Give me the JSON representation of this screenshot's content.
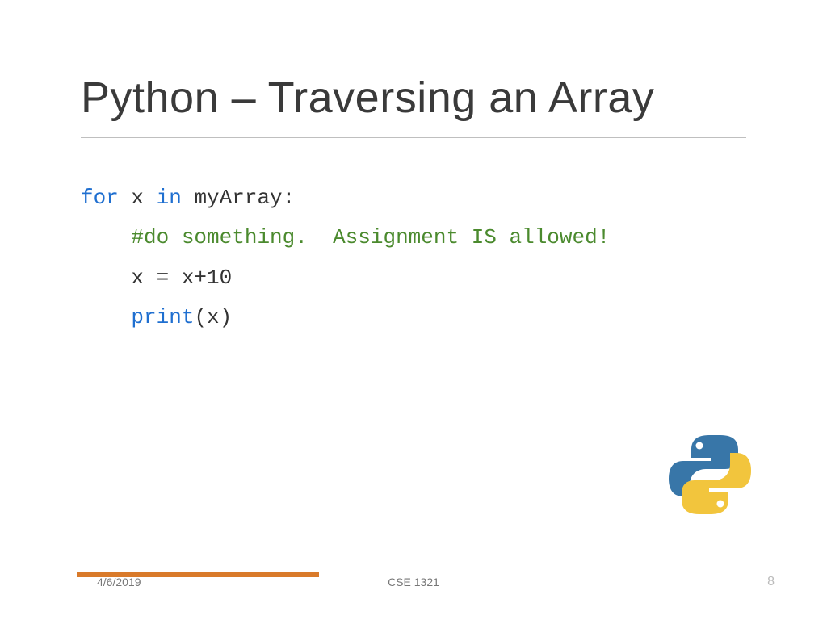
{
  "title": "Python – Traversing an Array",
  "code": {
    "line1": {
      "kw1": "for",
      "mid": " x ",
      "kw2": "in",
      "rest": " myArray:"
    },
    "line2": {
      "indent": "    ",
      "comment": "#do something.  Assignment IS allowed!"
    },
    "line3": {
      "indent": "    ",
      "text": "x = x+10"
    },
    "line4": {
      "indent": "    ",
      "func": "print",
      "rest": "(x)"
    }
  },
  "footer": {
    "date": "4/6/2019",
    "course": "CSE 1321",
    "page": "8"
  },
  "icons": {
    "logo": "python-logo"
  }
}
